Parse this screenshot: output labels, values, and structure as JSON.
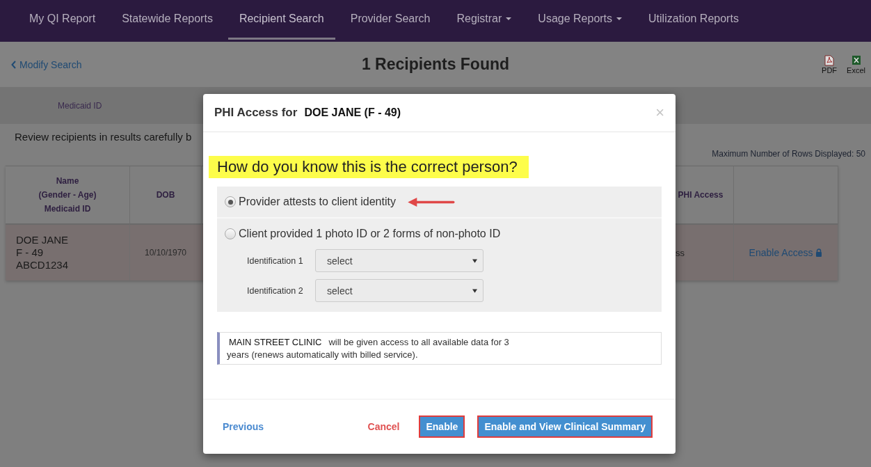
{
  "nav": {
    "items": [
      {
        "label": "My QI Report",
        "selected": false,
        "dropdown": false
      },
      {
        "label": "Statewide Reports",
        "selected": false,
        "dropdown": false
      },
      {
        "label": "Recipient Search",
        "selected": true,
        "dropdown": false
      },
      {
        "label": "Provider Search",
        "selected": false,
        "dropdown": false
      },
      {
        "label": "Registrar",
        "selected": false,
        "dropdown": true
      },
      {
        "label": "Usage Reports",
        "selected": false,
        "dropdown": true
      },
      {
        "label": "Utilization Reports",
        "selected": false,
        "dropdown": false
      }
    ]
  },
  "header": {
    "back_link": "Modify Search",
    "title": "1 Recipients Found",
    "exports": [
      {
        "kind": "pdf",
        "label": "PDF"
      },
      {
        "kind": "excel",
        "label": "Excel"
      }
    ]
  },
  "filter_band": {
    "column": "Medicaid ID"
  },
  "notice": "Review recipients in results carefully b",
  "max_rows": "Maximum Number of Rows Displayed: 50",
  "table": {
    "columns": [
      {
        "lines": [
          "Name",
          "(Gender - Age)",
          "Medicaid ID"
        ]
      },
      {
        "lines": [
          "DOB"
        ]
      },
      {
        "lines": [
          "PHI Access"
        ]
      }
    ],
    "rows": [
      {
        "name_lines": [
          "DOE JANE",
          "F - 49",
          "ABCD1234"
        ],
        "dob": "10/10/1970",
        "phi_access": "ss",
        "action": "Enable Access"
      }
    ]
  },
  "modal": {
    "title_prefix": "PHI Access for",
    "patient": "DOE JANE (F - 49)",
    "close": "×",
    "question": "How do you know this is the correct person?",
    "options": [
      {
        "label": "Provider attests to client identity",
        "selected": true,
        "annotated": true
      },
      {
        "label": "Client provided 1 photo ID or 2 forms of non-photo ID",
        "selected": false,
        "annotated": false
      }
    ],
    "id_fields": [
      {
        "label": "Identification 1",
        "value": "select"
      },
      {
        "label": "Identification 2",
        "value": "select"
      }
    ],
    "info": {
      "clinic": "MAIN STREET CLINIC",
      "text": "will be given access to all available data for 3",
      "text_2": "years (renews automatically with billed service)."
    },
    "footer": [
      {
        "kind": "link",
        "label": "Previous",
        "highlighted": false
      },
      {
        "kind": "cancel",
        "label": "Cancel",
        "highlighted": false
      },
      {
        "kind": "primary",
        "label": "Enable",
        "highlighted": true
      },
      {
        "kind": "primary",
        "label": "Enable and View Clinical Summary",
        "highlighted": true
      }
    ]
  }
}
